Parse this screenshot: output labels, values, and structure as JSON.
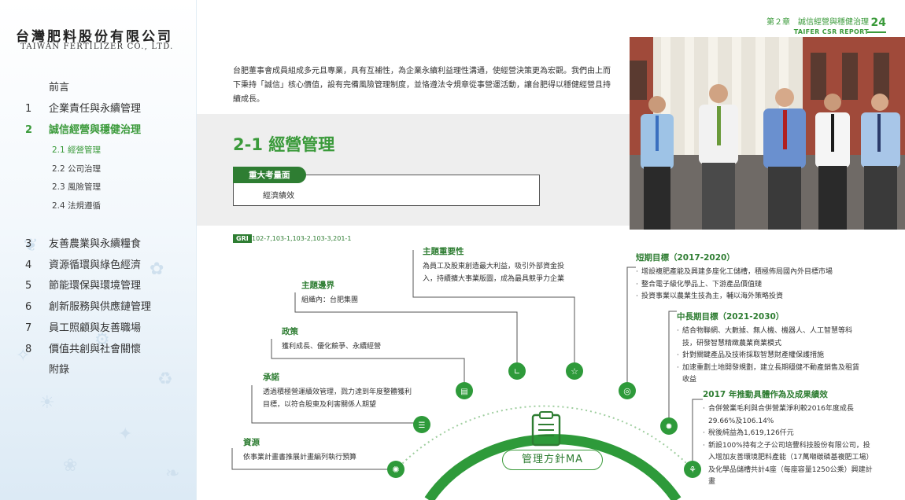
{
  "logo": {
    "cn": "台灣肥料股份有限公司",
    "en": "TAIWAN FERTILIZER CO., LTD."
  },
  "sidebar": {
    "items": [
      {
        "num": "",
        "label": "前言"
      },
      {
        "num": "1",
        "label": "企業責任與永續管理"
      },
      {
        "num": "2",
        "label": "誠信經營與穩健治理"
      },
      {
        "num": "3",
        "label": "友善農業與永續糧食"
      },
      {
        "num": "4",
        "label": "資源循環與綠色經濟"
      },
      {
        "num": "5",
        "label": "節能環保與環境管理"
      },
      {
        "num": "6",
        "label": "創新服務與供應鏈管理"
      },
      {
        "num": "7",
        "label": "員工照顧與友善職場"
      },
      {
        "num": "8",
        "label": "價值共創與社會關懷"
      },
      {
        "num": "",
        "label": "附錄"
      }
    ],
    "subitems": [
      "2.1 經營管理",
      "2.2 公司治理",
      "2.3 風險管理",
      "2.4 法規遵循"
    ]
  },
  "header": {
    "chapter": "第２章　誠信經營與穩健治理",
    "report": "TAIFER CSR REPORT",
    "page": "24"
  },
  "intro": "台肥董事會成員組成多元且專業，具有互補性，為企業永續利益理性溝通，使經營決策更為宏觀。我們由上而下秉持「誠信」核心價值，設有完備風險管理制度，並恪遵法令規章從事營運活動，讓台肥得以穩健經營且持續成長。",
  "section": {
    "title": "2-1  經營管理",
    "material_tag": "重大考量面",
    "material_text": "經濟績效"
  },
  "gri": {
    "tag": "GRI",
    "text": "102-7,103-1,103-2,103-3,201-1"
  },
  "diagram": {
    "center": "管理方針MA",
    "importance": {
      "title": "主題重要性",
      "body": "為員工及股東創造最大利益，吸引外部資金投入，持續擴大事業版圖，成為最具競爭力企業"
    },
    "boundary": {
      "title": "主題邊界",
      "body": "組織內：台肥集團"
    },
    "policy": {
      "title": "政策",
      "body": "獲利成長、優化競爭、永續經營"
    },
    "commitment": {
      "title": "承諾",
      "body": "透過積極營運績效管理，戮力達到年度整體獲利目標，以符合股東及利害關係人期望"
    },
    "resources": {
      "title": "資源",
      "body": "依事業計畫書推展計畫編列執行預算"
    },
    "short_term": {
      "title": "短期目標（2017-2020）",
      "items": [
        "增設複肥產能及興建多座化工儲槽，積極佈局國內外目標市場",
        "整合電子級化學品上、下游產品價值鏈",
        "投資事業以農業生技為主，輔以海外策略投資"
      ]
    },
    "mid_long_term": {
      "title": "中長期目標（2021-2030）",
      "items": [
        "結合物聯網、大數據、無人機、機器人、人工智慧等科技，研發智慧精緻農業商業模式",
        "針對關鍵產品及技術採取智慧財產權保護措施",
        "加速重劃土地開發規劃，建立長期穩健不動產銷售及租賃收益"
      ]
    },
    "results_2017": {
      "title": "2017 年推動具體作為及成果績效",
      "items": [
        "合併營業毛利與合併營業淨利較2016年度成長29.66%及106.14%",
        "稅後純益為1,619,126仟元",
        "新設100%持有之子公司培豐科技股份有限公司，投入增加友善環境肥料產能（17萬噸碳磷基複肥工場）及化學品儲槽共計4座（每座容量1250公乘）興建計畫"
      ]
    }
  },
  "colors": {
    "brand_green": "#3a9a3a",
    "dark_green": "#2e7d32"
  }
}
